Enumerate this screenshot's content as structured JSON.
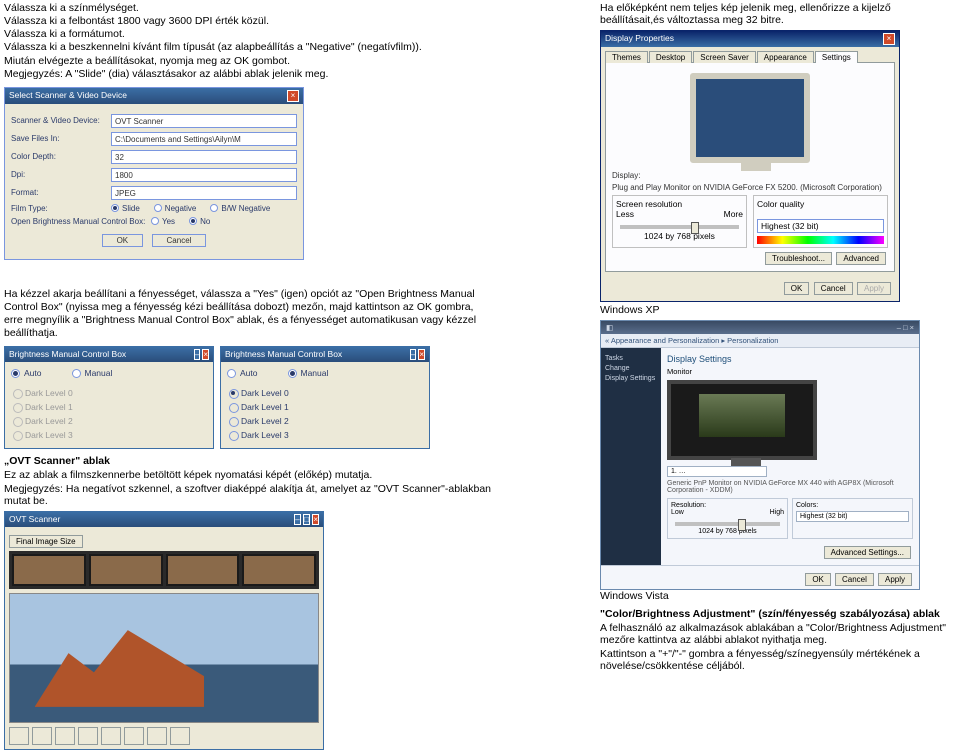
{
  "left": {
    "instructions": [
      "Válassza ki a színmélységet.",
      "Válassza ki a felbontást 1800 vagy 3600 DPI érték közül.",
      "Válassza ki a formátumot.",
      "Válassza ki a beszkennelni kívánt film típusát (az alapbeállítás a \"Negative\" (negatívfilm)).",
      "Miután elvégezte a beállításokat, nyomja meg az OK gombot.",
      "Megjegyzés: A \"Slide\" (dia) választásakor az alábbi ablak jelenik meg."
    ],
    "scanner": {
      "title": "Select Scanner & Video Device",
      "rows": {
        "device_lbl": "Scanner & Video Device:",
        "device_val": "OVT Scanner",
        "save_lbl": "Save Files In:",
        "save_val": "C:\\Documents and Settings\\Ailyn\\M",
        "color_lbl": "Color Depth:",
        "color_val": "32",
        "dpi_lbl": "Dpi:",
        "dpi_val": "1800",
        "format_lbl": "Format:",
        "format_val": "JPEG",
        "film_lbl": "Film Type:",
        "film_slide": "Slide",
        "film_neg": "Negative",
        "film_bw": "B/W Negative",
        "bright_lbl": "Open Brightness Manual Control Box:",
        "yes": "Yes",
        "no": "No"
      },
      "ok": "OK",
      "cancel": "Cancel"
    },
    "bright_text": "Ha kézzel akarja beállítani a fényességet, válassza a \"Yes\" (igen) opciót az \"Open Brightness Manual Control Box\" (nyissa meg a fényesség kézi beállítása dobozt) mezőn, majd kattintson az OK gombra, erre megnyílik a \"Brightness Manual Control Box\" ablak, és a fényességet automatikusan vagy kézzel beállíthatja.",
    "bright_box": {
      "title": "Brightness Manual Control Box",
      "auto": "Auto",
      "manual": "Manual",
      "levels": [
        "Dark Level 0",
        "Dark Level 1",
        "Dark Level 2",
        "Dark Level 3"
      ]
    },
    "ovt_head": "„OVT Scanner\" ablak",
    "ovt_text1": "Ez az ablak a filmszkennerbe betöltött képek nyomatási képét (előkép) mutatja.",
    "ovt_text2": "Megjegyzés: Ha negatívot szkennel, a szoftver diaképpé alakítja át, amelyet az \"OVT Scanner\"-ablakban mutat be.",
    "ovt_title": "OVT Scanner",
    "ovt_menu": "Final Image Size"
  },
  "right": {
    "preview_text": "Ha előképként nem teljes kép jelenik meg, ellenőrizze a kijelző beállításait,és változtassa meg 32 bitre.",
    "xp": {
      "title": "Display Properties",
      "tabs": [
        "Themes",
        "Desktop",
        "Screen Saver",
        "Appearance",
        "Settings"
      ],
      "display_lbl": "Display:",
      "display_val": "Plug and Play Monitor on NVIDIA GeForce FX 5200. (Microsoft Corporation)",
      "res_lbl": "Screen resolution",
      "less": "Less",
      "more": "More",
      "res_val": "1024 by 768 pixels",
      "color_lbl": "Color quality",
      "color_val": "Highest (32 bit)",
      "troubleshoot": "Troubleshoot...",
      "advanced": "Advanced",
      "ok": "OK",
      "cancel": "Cancel",
      "apply": "Apply"
    },
    "xp_caption": "Windows XP",
    "vista": {
      "crumb": "« Appearance and Personalization ▸ Personalization",
      "side": [
        "Tasks",
        "Change",
        "Display Settings"
      ],
      "header": "Display Settings",
      "monitor_lbl": "Monitor",
      "desc": "Generic PnP Monitor on NVIDIA GeForce MX 440 with AGP8X (Microsoft Corporation - XDDM)",
      "res_lbl": "Resolution:",
      "low": "Low",
      "high": "High",
      "res_val": "1024 by 768 pixels",
      "col_lbl": "Colors:",
      "col_val": "Highest (32 bit)",
      "adv": "Advanced Settings...",
      "ok": "OK",
      "cancel": "Cancel",
      "apply": "Apply"
    },
    "vista_caption": "Windows Vista",
    "cb_head": "\"Color/Brightness Adjustment\" (szín/fényesség szabályozása) ablak",
    "cb_text1": "A felhasználó az alkalmazások ablakában a \"Color/Brightness Adjustment\" mezőre kattintva az alábbi ablakot nyithatja meg.",
    "cb_text2": "Kattintson a \"+\"/\"-\" gombra a fényesség/színegyensúly mértékének a növelése/csökkentése céljából."
  }
}
